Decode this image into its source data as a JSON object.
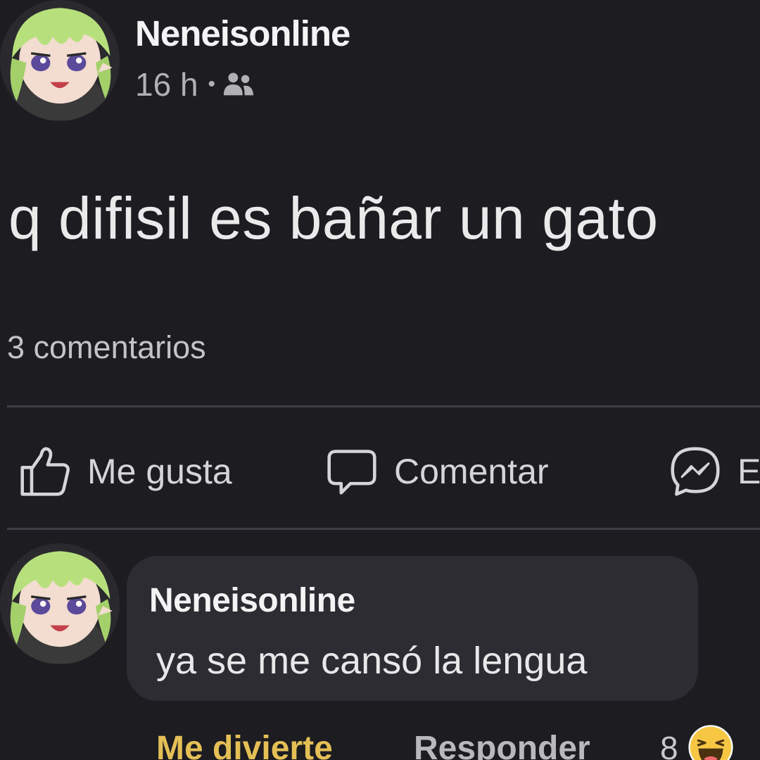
{
  "post": {
    "author": "Neneisonline",
    "time": "16 h",
    "separator": "•",
    "audience_icon": "friends-icon",
    "text": "q difisil es bañar un gato",
    "comment_count_label": "3 comentarios"
  },
  "actions": {
    "like_label": "Me gusta",
    "comment_label": "Comentar",
    "send_label": "E"
  },
  "comment": {
    "author": "Neneisonline",
    "text": "ya se me cansó la lengua",
    "reaction_label": "Me divierte",
    "reply_label": "Responder",
    "reaction_count": "8",
    "reaction_icon": "haha-emoji-icon"
  },
  "colors": {
    "background": "#1c1c21",
    "bubble": "#2c2c32",
    "reaction_active": "#e4bf55"
  }
}
